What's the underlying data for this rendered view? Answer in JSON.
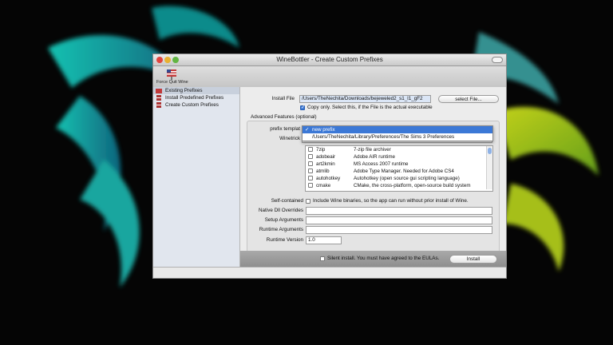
{
  "window": {
    "title": "WineBottler - Create Custom Prefixes"
  },
  "toolbar": {
    "force_quit_label": "Force Quit Wine"
  },
  "sidebar": {
    "items": [
      {
        "label": "Existing Prefixes"
      },
      {
        "label": "Install Predefined Prefixes"
      },
      {
        "label": "Create Custom Prefixes"
      }
    ]
  },
  "form": {
    "install_file_label": "Install File",
    "install_file_value": "/Users/TheNechita/Downloads/bejeweled2_s1_l1_gF2",
    "select_file_button": "select File...",
    "copy_only_label": "Copy only. Select this, if the File is the actual executable",
    "copy_only_checked": true,
    "advanced_title": "Advanced Features (optional)",
    "prefix_template_label": "prefix templat",
    "winetricks_label": "Winetrick",
    "self_contained_label": "Self-contained",
    "self_contained_text": "Include Wine binaries, so the app can run without prior install of Wine.",
    "native_dll_label": "Native Dll Overrides",
    "setup_args_label": "Setup Arguments",
    "runtime_args_label": "Runtime Arguments",
    "runtime_version_label": "Runtime Version",
    "runtime_version_value": "1.0"
  },
  "prefix_dropdown": {
    "options": [
      {
        "label": "new prefix",
        "selected": true
      },
      {
        "label": "/Users/TheNechita/Library/Preferences/The Sims 3 Preferences",
        "selected": false
      }
    ]
  },
  "winetricks": [
    {
      "name": "7zip",
      "desc": "7-zip file archiver"
    },
    {
      "name": "adobeair",
      "desc": "Adobe AIR runtime"
    },
    {
      "name": "art2kmin",
      "desc": "MS Access 2007 runtime"
    },
    {
      "name": "atmlib",
      "desc": "Adobe Type Manager. Needed for Adobe CS4"
    },
    {
      "name": "autohotkey",
      "desc": "Autohotkey (open source gui scripting language)"
    },
    {
      "name": "cmake",
      "desc": "CMake, the cross-platform, open-source build system"
    }
  ],
  "footer": {
    "silent_install_label": "Silent install. You must have agreed to the EULAs.",
    "install_button": "Install"
  },
  "colors": {
    "selection": "#3b78d6",
    "wallpaper_glow": "#2de0c0"
  }
}
